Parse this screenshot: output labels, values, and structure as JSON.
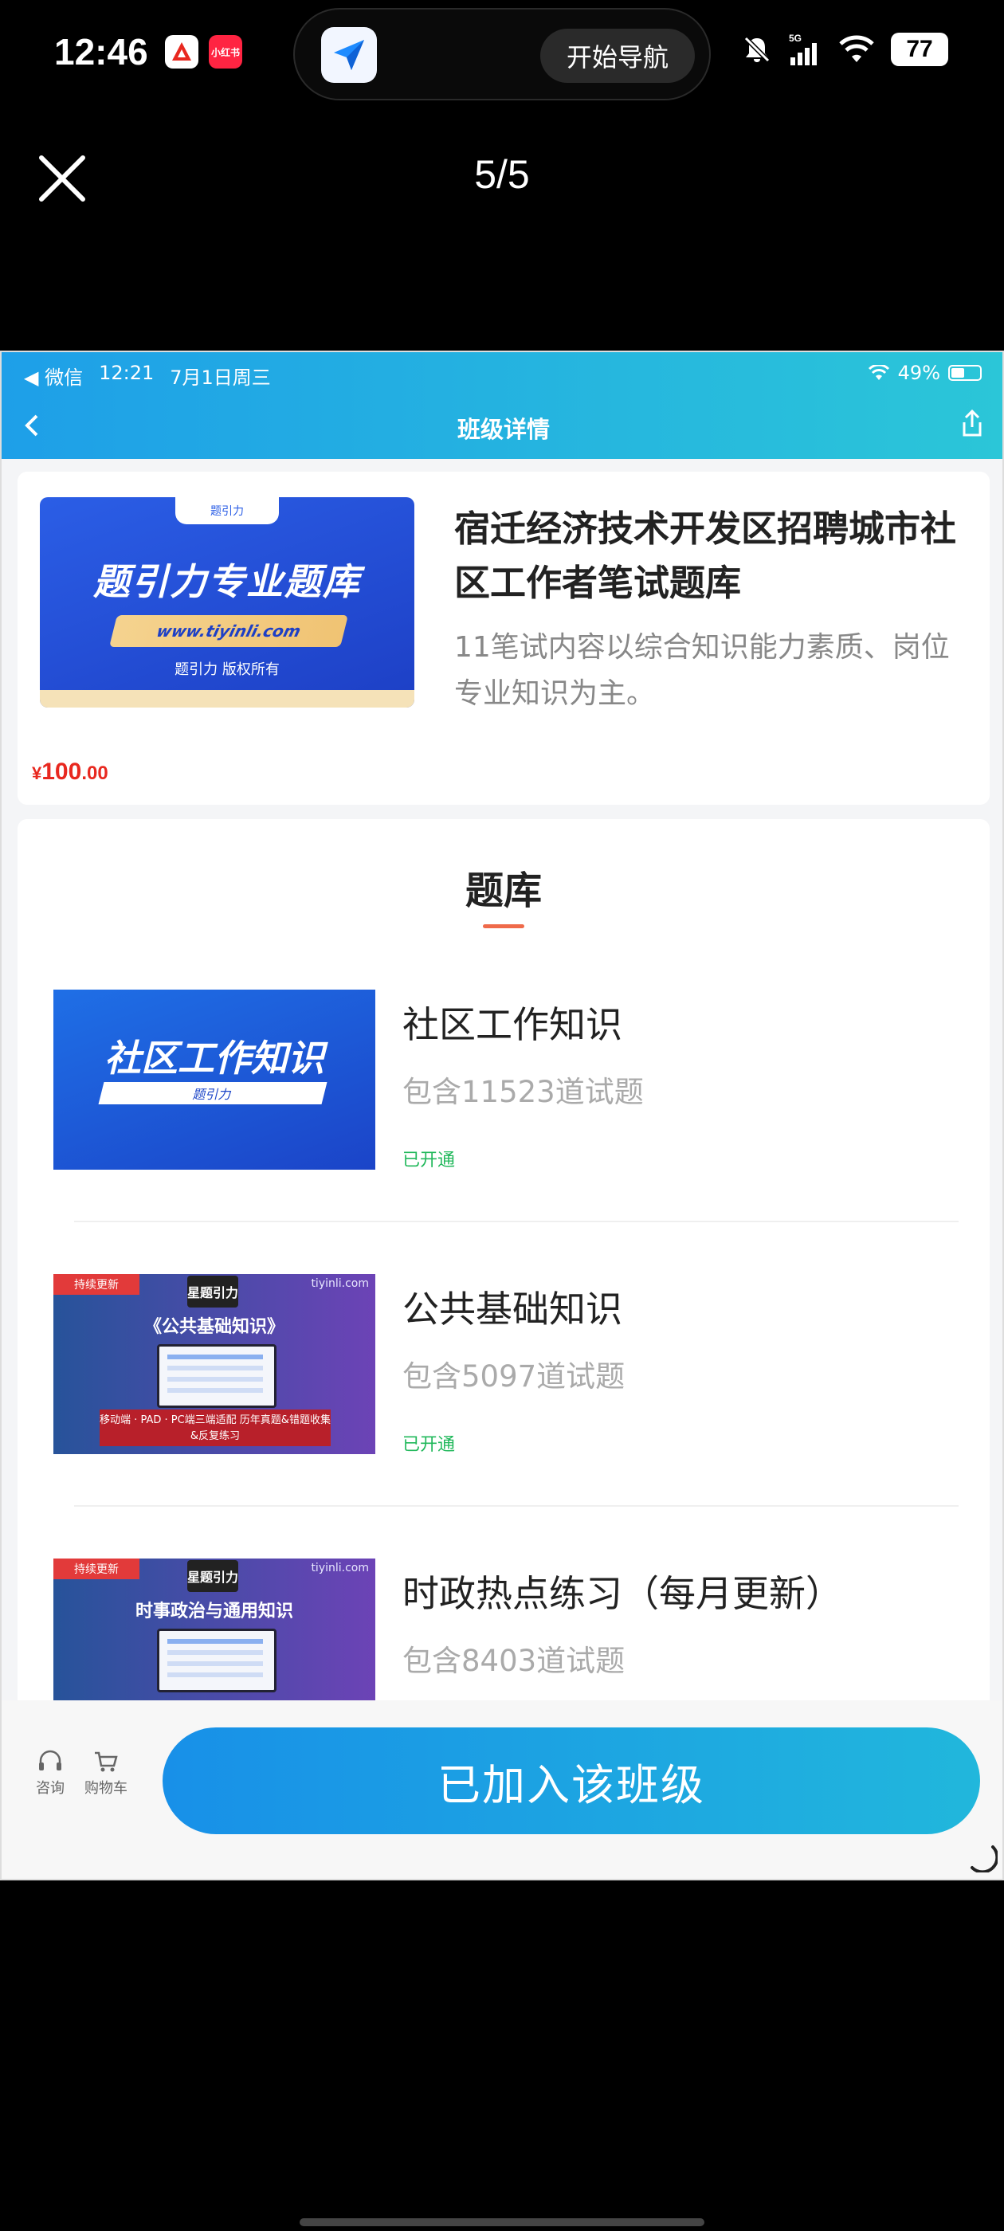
{
  "os_status": {
    "time": "12:46",
    "island_button": "开始导航",
    "network": "5G",
    "battery": "77"
  },
  "viewer": {
    "counter": "5/5"
  },
  "inner": {
    "status_left": [
      "◀ 微信",
      "12:21",
      "7月1日周三"
    ],
    "status_right": "49%",
    "title": "班级详情"
  },
  "course": {
    "banner_tag": "题引力",
    "banner_title": "题引力专业题库",
    "banner_url": "www.tiyinli.com",
    "banner_copyright": "题引力 版权所有",
    "title": "宿迁经济技术开发区招聘城市社区工作者笔试题库",
    "description": "11笔试内容以综合知识能力素质、岗位专业知识为主。",
    "price_currency": "¥",
    "price_int": "100",
    "price_dec": ".00"
  },
  "section": {
    "title": "题库"
  },
  "items": [
    {
      "name": "社区工作知识",
      "count": "包含11523道试题",
      "status": "已开通",
      "thumb_title": "社区工作知识",
      "thumb_sub": "题引力"
    },
    {
      "name": "公共基础知识",
      "count": "包含5097道试题",
      "status": "已开通",
      "thumb_tag": "持续更新",
      "thumb_site": "tiyinli.com",
      "thumb_logo": "星题引力",
      "thumb_heading": "《公共基础知识》",
      "thumb_red": "移动端 · PAD · PC端三端适配 历年真题&错题收集&反复练习"
    },
    {
      "name": "时政热点练习（每月更新）",
      "count": "包含8403道试题",
      "thumb_tag": "持续更新",
      "thumb_site": "tiyinli.com",
      "thumb_logo": "星题引力",
      "thumb_heading": "时事政治与通用知识"
    }
  ],
  "bottom_bar": {
    "consult_label": "咨询",
    "cart_label": "购物车",
    "join_button": "已加入该班级"
  },
  "colors": {
    "header_gradient_start": "#1e9fe8",
    "header_gradient_end": "#2bc6d8",
    "price": "#e8281f",
    "status_green": "#21b85b",
    "accent_underline": "#ef6a4a"
  }
}
